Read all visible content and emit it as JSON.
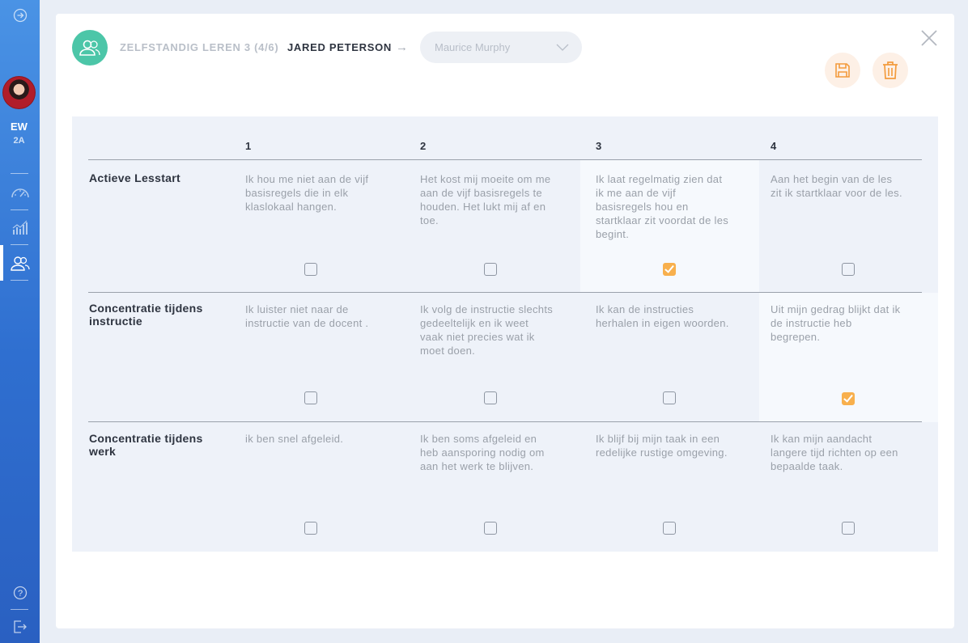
{
  "sidebar": {
    "initials": "EW",
    "group": "2A",
    "icons": [
      "collapse-icon",
      "dashboard-icon",
      "stats-icon",
      "students-icon",
      "help-icon",
      "logout-icon"
    ]
  },
  "header": {
    "breadcrumb": "ZELFSTANDIG LEREN 3 (4/6)",
    "student": "JARED PETERSON",
    "arrow": "→",
    "select_placeholder": "Maurice Murphy"
  },
  "colors": {
    "accent": "#f8b04d",
    "teal": "#4cc6a8",
    "sidebar": "#3a7fdb"
  },
  "table": {
    "columns": [
      "1",
      "2",
      "3",
      "4"
    ],
    "rows": [
      {
        "label": "Actieve Lesstart",
        "cells": [
          "Ik hou me niet aan de vijf basisregels die in elk klaslokaal hangen.",
          "Het kost mij moeite om me aan de vijf basisregels te houden. Het lukt mij af en toe.",
          "Ik laat regelmatig zien dat ik me aan de vijf basisregels hou en startklaar zit voordat de les begint.",
          "Aan het begin van de les zit ik startklaar voor de les."
        ],
        "checked": [
          false,
          false,
          true,
          false
        ]
      },
      {
        "label": "Concentratie tijdens instructie",
        "cells": [
          "Ik luister niet naar de instructie van de docent .",
          "Ik volg de instructie slechts gedeeltelijk en ik weet vaak niet precies wat ik moet doen.",
          "Ik kan de instructies herhalen in eigen woorden.",
          "Uit mijn gedrag blijkt dat ik de instructie heb begrepen."
        ],
        "checked": [
          false,
          false,
          false,
          true
        ]
      },
      {
        "label": "Concentratie tijdens werk",
        "cells": [
          "ik ben snel afgeleid.",
          "Ik ben soms afgeleid en heb aansporing nodig om aan het werk te blijven.",
          "Ik blijf bij mijn taak in een redelijke rustige omgeving.",
          "Ik kan mijn aandacht langere tijd richten op een bepaalde taak."
        ],
        "checked": [
          false,
          false,
          false,
          false
        ]
      }
    ]
  }
}
